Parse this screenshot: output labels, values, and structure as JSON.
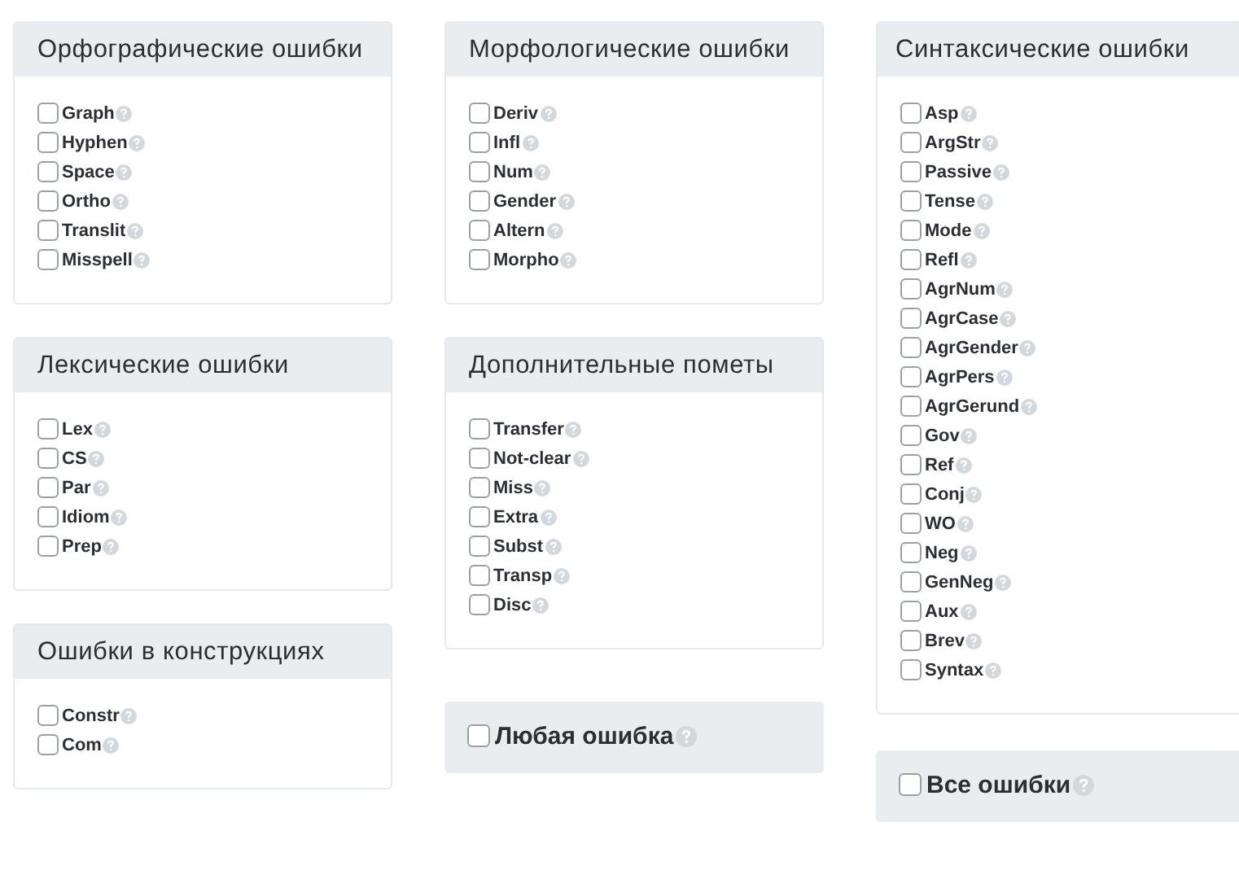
{
  "columns": [
    {
      "panels": [
        {
          "kind": "group",
          "title": "Орфографические ошибки",
          "items": [
            {
              "label": "Graph",
              "checked": false
            },
            {
              "label": "Hyphen",
              "checked": false
            },
            {
              "label": "Space",
              "checked": false
            },
            {
              "label": "Ortho",
              "checked": false
            },
            {
              "label": "Translit",
              "checked": false
            },
            {
              "label": "Misspell",
              "checked": false
            }
          ]
        },
        {
          "kind": "group",
          "title": "Лексические ошибки",
          "items": [
            {
              "label": "Lex",
              "checked": false
            },
            {
              "label": "CS",
              "checked": false
            },
            {
              "label": "Par",
              "checked": false
            },
            {
              "label": "Idiom",
              "checked": false
            },
            {
              "label": "Prep",
              "checked": false
            }
          ]
        },
        {
          "kind": "group",
          "title": "Ошибки в конструкциях",
          "items": [
            {
              "label": "Constr",
              "checked": false
            },
            {
              "label": "Com",
              "checked": false
            }
          ]
        }
      ]
    },
    {
      "panels": [
        {
          "kind": "group",
          "title": "Морфологические ошибки",
          "items": [
            {
              "label": "Deriv",
              "checked": false
            },
            {
              "label": "Infl",
              "checked": false
            },
            {
              "label": "Num",
              "checked": false
            },
            {
              "label": "Gender",
              "checked": false
            },
            {
              "label": "Altern",
              "checked": false
            },
            {
              "label": "Morpho",
              "checked": false
            }
          ]
        },
        {
          "kind": "group",
          "title": "Дополнительные пометы",
          "items": [
            {
              "label": "Transfer",
              "checked": false
            },
            {
              "label": "Not-clear",
              "checked": false
            },
            {
              "label": "Miss",
              "checked": false
            },
            {
              "label": "Extra",
              "checked": false
            },
            {
              "label": "Subst",
              "checked": false
            },
            {
              "label": "Transp",
              "checked": false
            },
            {
              "label": "Disc",
              "checked": false
            }
          ]
        },
        {
          "kind": "all",
          "label": "Любая ошибка",
          "checked": false
        }
      ]
    },
    {
      "panels": [
        {
          "kind": "group",
          "title": "Синтаксические ошибки",
          "items": [
            {
              "label": "Asp",
              "checked": false
            },
            {
              "label": "ArgStr",
              "checked": false
            },
            {
              "label": "Passive",
              "checked": false
            },
            {
              "label": "Tense",
              "checked": false
            },
            {
              "label": "Mode",
              "checked": false
            },
            {
              "label": "Refl",
              "checked": false
            },
            {
              "label": "AgrNum",
              "checked": false
            },
            {
              "label": "AgrCase",
              "checked": false
            },
            {
              "label": "AgrGender",
              "checked": false
            },
            {
              "label": "AgrPers",
              "checked": false
            },
            {
              "label": "AgrGerund",
              "checked": false
            },
            {
              "label": "Gov",
              "checked": false
            },
            {
              "label": "Ref",
              "checked": false
            },
            {
              "label": "Conj",
              "checked": false
            },
            {
              "label": "WO",
              "checked": false
            },
            {
              "label": "Neg",
              "checked": false
            },
            {
              "label": "GenNeg",
              "checked": false
            },
            {
              "label": "Aux",
              "checked": false
            },
            {
              "label": "Brev",
              "checked": false
            },
            {
              "label": "Syntax",
              "checked": false
            }
          ]
        },
        {
          "kind": "all",
          "label": "Все ошибки",
          "checked": false
        }
      ]
    }
  ]
}
